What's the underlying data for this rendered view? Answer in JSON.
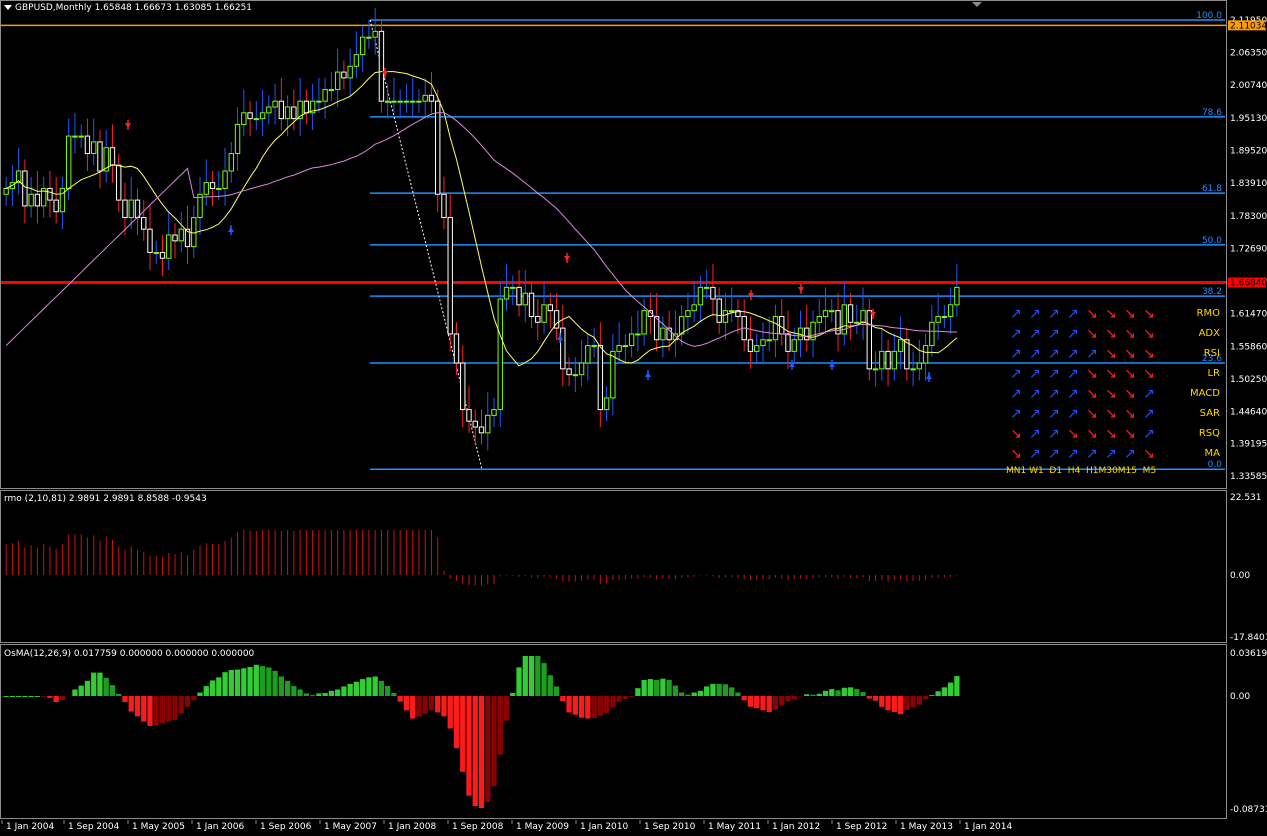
{
  "window": {
    "symbol_header": "GBPUSD,Monthly  1.65848 1.66673 1.63085 1.66251"
  },
  "main_pane": {
    "price_scale": [
      "2.11950",
      "2.06350",
      "2.00740",
      "1.95130",
      "1.89520",
      "1.83910",
      "1.78300",
      "1.72690",
      "1.67080",
      "1.61470",
      "1.55860",
      "1.50250",
      "1.44640",
      "1.39195",
      "1.33585"
    ],
    "price_min": 1.33585,
    "price_max": 2.1195,
    "hline_orange": {
      "price": 2.11034,
      "label": "2.11034",
      "color": "#ff9a00"
    },
    "hline_red": {
      "price": 1.6684,
      "label": "1.66840",
      "color": "#ff0000"
    },
    "fib_levels": [
      {
        "label": "100.0",
        "price": 2.1195
      },
      {
        "label": "78.6",
        "price": 1.953
      },
      {
        "label": "61.8",
        "price": 1.822
      },
      {
        "label": "50.0",
        "price": 1.733
      },
      {
        "label": "38.2",
        "price": 1.645
      },
      {
        "label": "23.6",
        "price": 1.53
      },
      {
        "label": "0.0",
        "price": 1.3475
      }
    ],
    "fib_color": "#1e90ff",
    "candle_up_color": "#7cfc00",
    "candle_down_color": "#ffffff"
  },
  "signal_table": {
    "rows": [
      {
        "name": "RMO",
        "arrows": [
          "u",
          "u",
          "u",
          "u",
          "d",
          "d",
          "d",
          "d"
        ]
      },
      {
        "name": "ADX",
        "arrows": [
          "u",
          "u",
          "u",
          "u",
          "d",
          "d",
          "d",
          "d"
        ]
      },
      {
        "name": "RSI",
        "arrows": [
          "u",
          "u",
          "u",
          "u",
          "u",
          "d",
          "d",
          "d"
        ]
      },
      {
        "name": "LR",
        "arrows": [
          "u",
          "u",
          "u",
          "u",
          "d",
          "d",
          "d",
          "d"
        ]
      },
      {
        "name": "MACD",
        "arrows": [
          "u",
          "u",
          "u",
          "u",
          "d",
          "d",
          "d",
          "u"
        ]
      },
      {
        "name": "SAR",
        "arrows": [
          "u",
          "u",
          "u",
          "u",
          "d",
          "d",
          "d",
          "u"
        ]
      },
      {
        "name": "RSQ",
        "arrows": [
          "d",
          "u",
          "u",
          "d",
          "d",
          "d",
          "d",
          "u"
        ]
      },
      {
        "name": "MA",
        "arrows": [
          "d",
          "u",
          "u",
          "u",
          "u",
          "u",
          "u",
          "d"
        ]
      }
    ],
    "timeframes": "MN1 W1  D1  H4  H1M30M15  M5",
    "label_color": "#ffd700",
    "up_color": "#1e50ff",
    "down_color": "#ff2020"
  },
  "rmo_pane": {
    "header": "rmo (2,10,81) 2.9891 2.9891 8.8588 -0.9543",
    "scale": [
      "22.531",
      "0.00",
      "-17.8401"
    ],
    "color": "#cc1010"
  },
  "osma_pane": {
    "header": "OsMA(12,26,9) 0.017759 0.000000 0.000000 0.000000",
    "scale": [
      "0.036198",
      "0.00",
      "-0.087319"
    ]
  },
  "time_axis": [
    "1 Jan 2004",
    "1 Sep 2004",
    "1 May 2005",
    "1 Jan 2006",
    "1 Sep 2006",
    "1 May 2007",
    "1 Jan 2008",
    "1 Sep 2008",
    "1 May 2009",
    "1 Jan 2010",
    "1 Sep 2010",
    "1 May 2011",
    "1 Jan 2012",
    "1 Sep 2012",
    "1 May 2013",
    "1 Jan 2014"
  ]
}
